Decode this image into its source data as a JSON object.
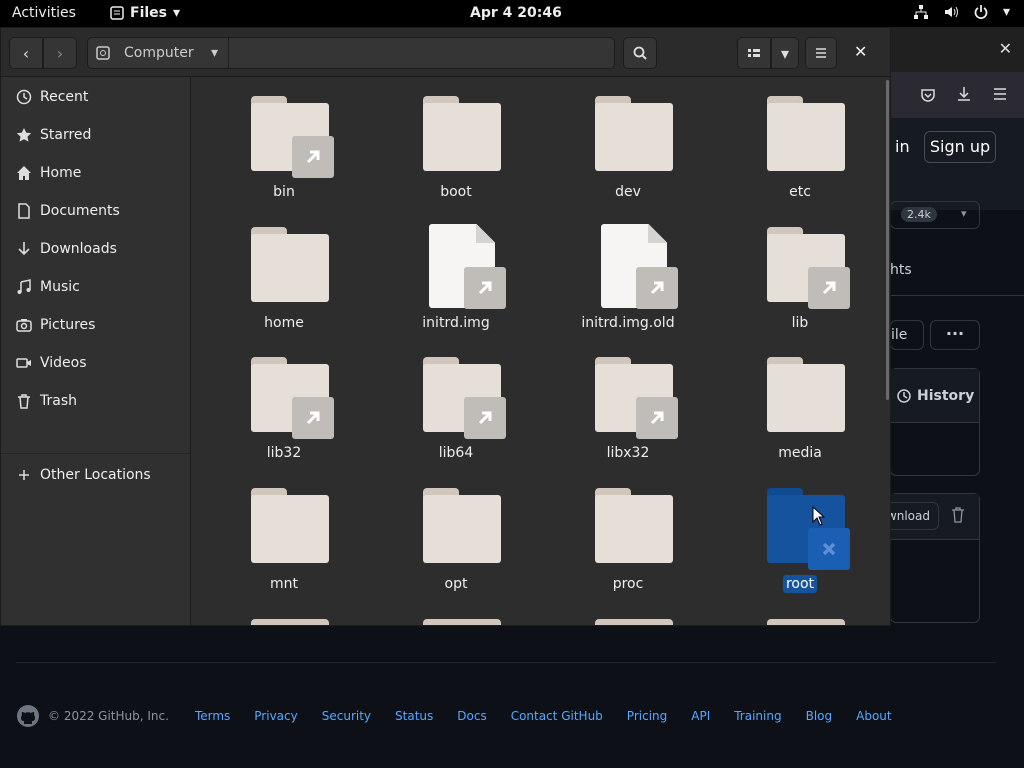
{
  "topbar": {
    "activities": "Activities",
    "app": "Files",
    "clock": "Apr 4  20:46"
  },
  "window": {
    "location": "Computer",
    "sidebar": [
      {
        "label": "Recent",
        "icon": "clock-icon"
      },
      {
        "label": "Starred",
        "icon": "star-icon"
      },
      {
        "label": "Home",
        "icon": "home-icon"
      },
      {
        "label": "Documents",
        "icon": "document-icon"
      },
      {
        "label": "Downloads",
        "icon": "download-icon"
      },
      {
        "label": "Music",
        "icon": "music-icon"
      },
      {
        "label": "Pictures",
        "icon": "camera-icon"
      },
      {
        "label": "Videos",
        "icon": "video-icon"
      },
      {
        "label": "Trash",
        "icon": "trash-icon"
      },
      {
        "label": "Other Locations",
        "icon": "plus-icon"
      }
    ],
    "items": [
      {
        "name": "bin",
        "type": "folder",
        "link": true
      },
      {
        "name": "boot",
        "type": "folder",
        "link": false
      },
      {
        "name": "dev",
        "type": "folder",
        "link": false
      },
      {
        "name": "etc",
        "type": "folder",
        "link": false
      },
      {
        "name": "home",
        "type": "folder",
        "link": false
      },
      {
        "name": "initrd.img",
        "type": "file",
        "link": true
      },
      {
        "name": "initrd.img.old",
        "type": "file",
        "link": true
      },
      {
        "name": "lib",
        "type": "folder",
        "link": true
      },
      {
        "name": "lib32",
        "type": "folder",
        "link": true
      },
      {
        "name": "lib64",
        "type": "folder",
        "link": true
      },
      {
        "name": "libx32",
        "type": "folder",
        "link": true
      },
      {
        "name": "media",
        "type": "folder",
        "link": false
      },
      {
        "name": "mnt",
        "type": "folder",
        "link": false
      },
      {
        "name": "opt",
        "type": "folder",
        "link": false
      },
      {
        "name": "proc",
        "type": "folder",
        "link": false
      },
      {
        "name": "root",
        "type": "folder",
        "link": false,
        "locked": true,
        "selected": true
      }
    ]
  },
  "background_page": {
    "signin": "in",
    "signup": "Sign up",
    "count": "2.4k",
    "insights": "hts",
    "file_btn": "ile",
    "history": "History",
    "download": "wnload"
  },
  "footer": {
    "copyright": "© 2022 GitHub, Inc.",
    "links": [
      "Terms",
      "Privacy",
      "Security",
      "Status",
      "Docs",
      "Contact GitHub",
      "Pricing",
      "API",
      "Training",
      "Blog",
      "About"
    ]
  },
  "colors": {
    "accent": "#15539e",
    "link": "#58a6ff",
    "folder": "#e6dfd8"
  }
}
